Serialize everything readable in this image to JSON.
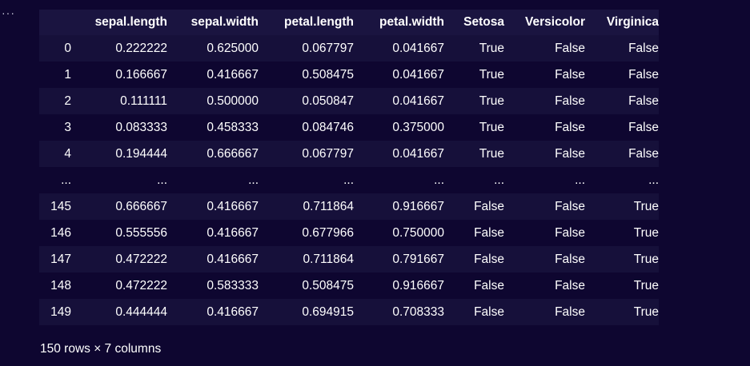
{
  "output": {
    "menu_glyph": "···"
  },
  "dataframe": {
    "columns": [
      "",
      "sepal.length",
      "sepal.width",
      "petal.length",
      "petal.width",
      "Setosa",
      "Versicolor",
      "Virginica"
    ],
    "rows": [
      [
        "0",
        "0.222222",
        "0.625000",
        "0.067797",
        "0.041667",
        "True",
        "False",
        "False"
      ],
      [
        "1",
        "0.166667",
        "0.416667",
        "0.508475",
        "0.041667",
        "True",
        "False",
        "False"
      ],
      [
        "2",
        "0.111111",
        "0.500000",
        "0.050847",
        "0.041667",
        "True",
        "False",
        "False"
      ],
      [
        "3",
        "0.083333",
        "0.458333",
        "0.084746",
        "0.375000",
        "True",
        "False",
        "False"
      ],
      [
        "4",
        "0.194444",
        "0.666667",
        "0.067797",
        "0.041667",
        "True",
        "False",
        "False"
      ],
      [
        "...",
        "...",
        "...",
        "...",
        "...",
        "...",
        "...",
        "..."
      ],
      [
        "145",
        "0.666667",
        "0.416667",
        "0.711864",
        "0.916667",
        "False",
        "False",
        "True"
      ],
      [
        "146",
        "0.555556",
        "0.416667",
        "0.677966",
        "0.750000",
        "False",
        "False",
        "True"
      ],
      [
        "147",
        "0.472222",
        "0.416667",
        "0.711864",
        "0.791667",
        "False",
        "False",
        "True"
      ],
      [
        "148",
        "0.472222",
        "0.583333",
        "0.508475",
        "0.916667",
        "False",
        "False",
        "True"
      ],
      [
        "149",
        "0.444444",
        "0.416667",
        "0.694915",
        "0.708333",
        "False",
        "False",
        "True"
      ]
    ],
    "footer": "150 rows × 7 columns"
  },
  "colors": {
    "background": "#0e0630",
    "header_row": "#1a1440",
    "stripe_row": "#16103a",
    "text": "#ffffff"
  }
}
